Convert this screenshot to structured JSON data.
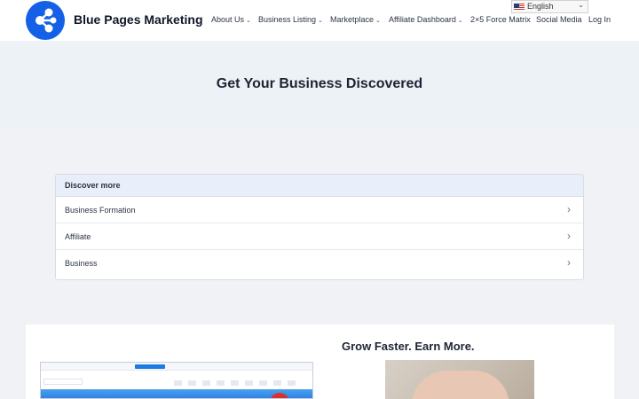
{
  "header": {
    "brand": "Blue Pages Marketing",
    "logo_icon": "share-nodes-icon",
    "nav": [
      {
        "label": "About Us",
        "dropdown": true
      },
      {
        "label": "Business Listing",
        "dropdown": true
      },
      {
        "label": "Marketplace",
        "dropdown": true
      },
      {
        "label": "Affiliate Dashboard",
        "dropdown": true
      },
      {
        "label": "2×5 Force Matrix",
        "dropdown": false
      },
      {
        "label": "Social Media",
        "dropdown": false
      },
      {
        "label": "Log In",
        "dropdown": false
      }
    ],
    "language": {
      "selected": "English",
      "flag_icon": "us-flag-icon"
    }
  },
  "hero": {
    "title": "Get Your Business Discovered"
  },
  "discover": {
    "title": "Discover more",
    "items": [
      "Business Formation",
      "Affiliate",
      "Business"
    ]
  },
  "card": {
    "title": "Grow Faster. Earn More."
  },
  "colors": {
    "brand_blue": "#1461e8",
    "hero_bg": "#edf2f7",
    "discover_head_bg": "#e8effb"
  }
}
